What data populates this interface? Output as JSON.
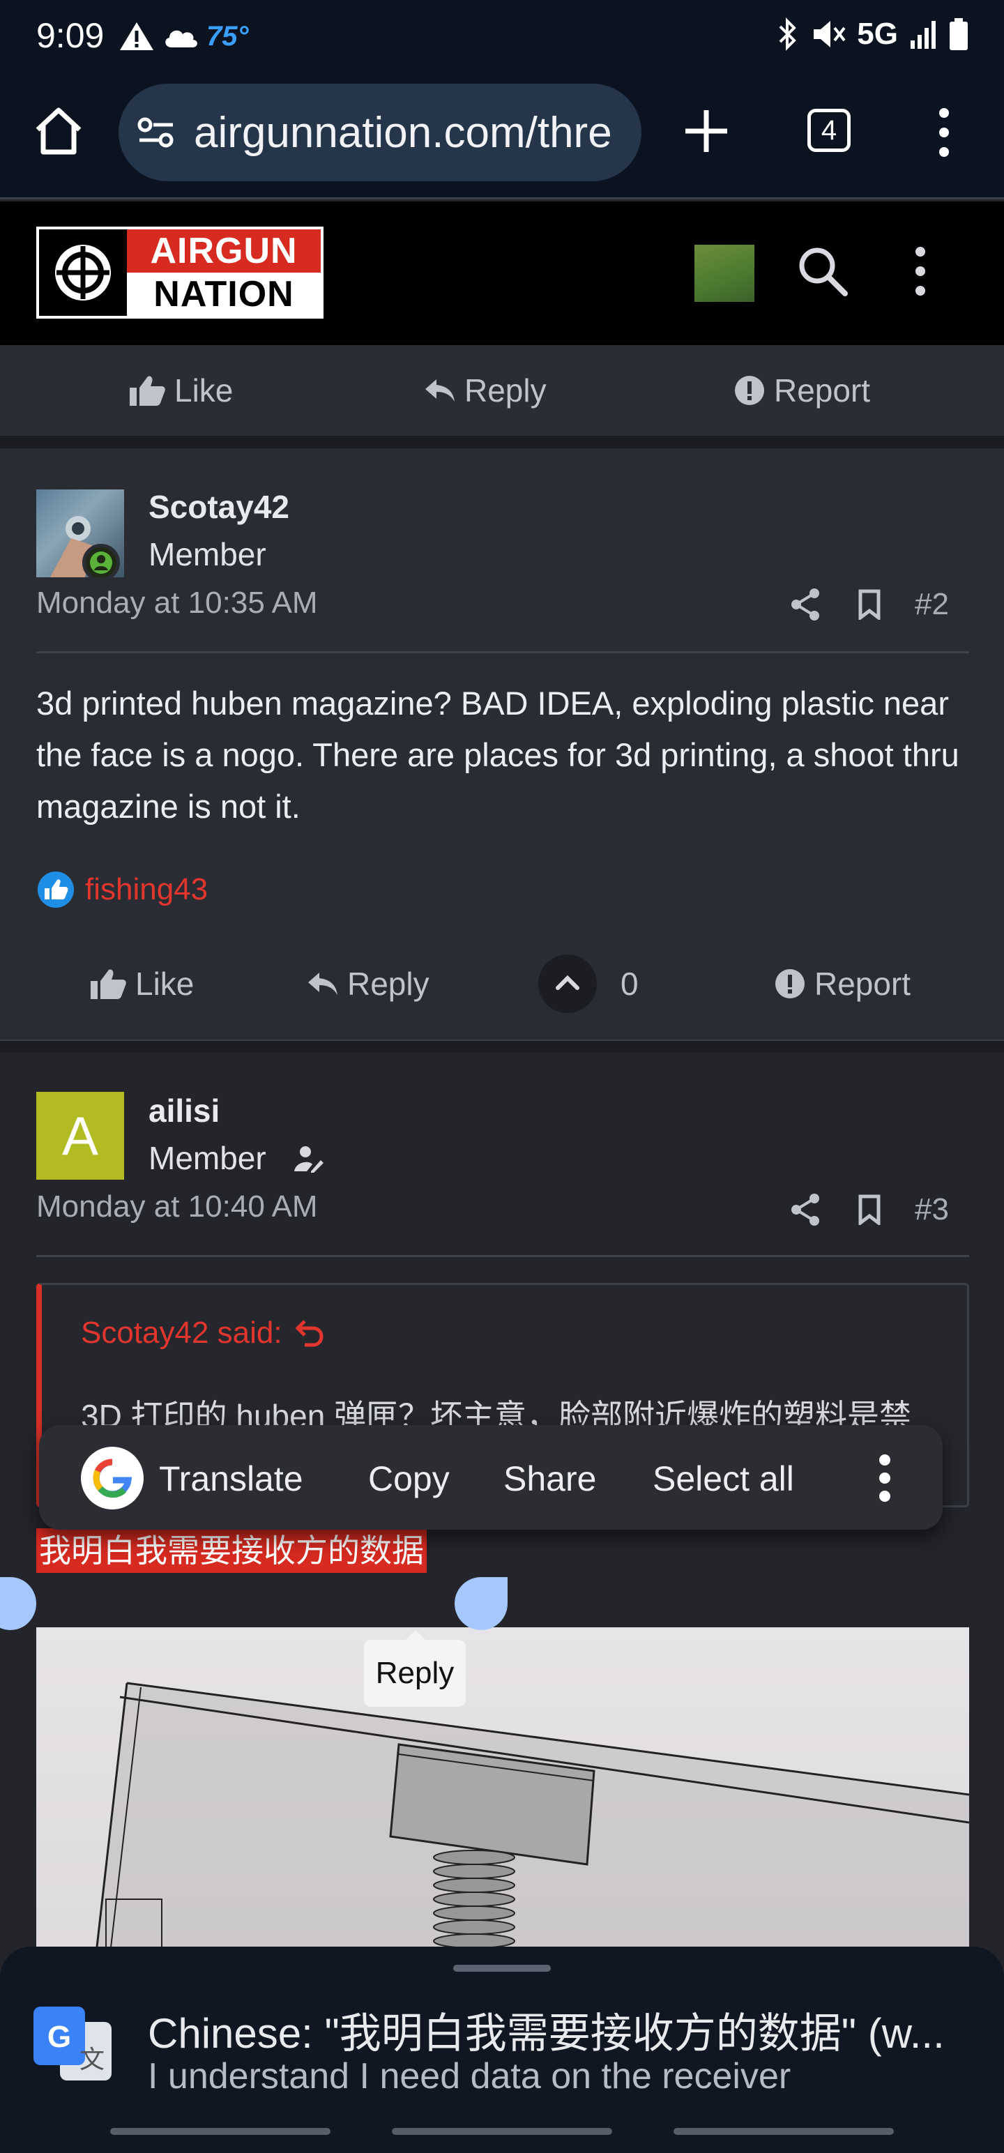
{
  "status_bar": {
    "time": "9:09",
    "temperature": "75°",
    "network": "5G",
    "icons": [
      "warning-icon",
      "cloud-icon",
      "bluetooth-icon",
      "mute-icon",
      "signal-icon",
      "battery-icon"
    ]
  },
  "browser": {
    "url": "airgunnation.com/thre",
    "tab_count": "4"
  },
  "site": {
    "logo_top": "AIRGUN",
    "logo_bottom": "NATION"
  },
  "top_actions": {
    "like": "Like",
    "reply": "Reply",
    "report": "Report"
  },
  "post2": {
    "username": "Scotay42",
    "user_title": "Member",
    "date": "Monday at 10:35 AM",
    "post_number": "#2",
    "body": "3d printed huben magazine? BAD IDEA, exploding plastic near the face is a nogo. There are places for 3d printing, a shoot thru magazine is not it.",
    "reaction_user": "fishing43",
    "actions": {
      "like": "Like",
      "reply": "Reply",
      "vote_count": "0",
      "report": "Report"
    }
  },
  "post3": {
    "avatar_letter": "A",
    "username": "ailisi",
    "user_title": "Member",
    "date": "Monday at 10:40 AM",
    "post_number": "#3",
    "quote_author": "Scotay42 said:",
    "quote_text": "3D 打印的 huben 弹匣？坏主意，脸部附近爆炸的塑料是禁",
    "selected_text": "我明白我需要接收方的数据"
  },
  "context_menu": {
    "translate": "Translate",
    "copy": "Copy",
    "share": "Share",
    "select_all": "Select all"
  },
  "reply_tooltip": "Reply",
  "translate_sheet": {
    "title": "Chinese: \"我明白我需要接收方的数据\" (w...",
    "translation": "I understand I need data on the receiver"
  },
  "colors": {
    "accent_red": "#d72a20",
    "background": "#23252b",
    "link_red": "#e2352e"
  }
}
